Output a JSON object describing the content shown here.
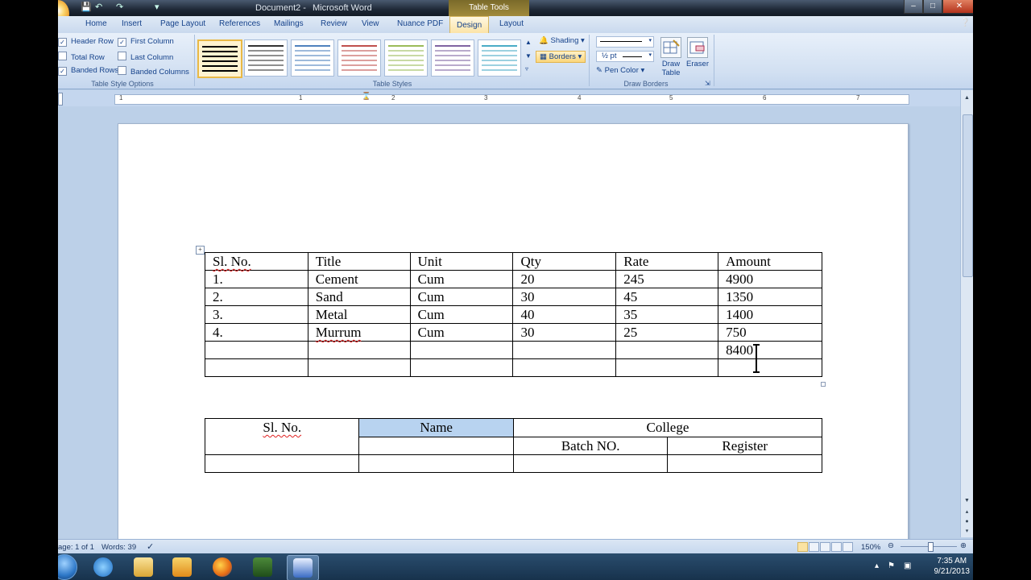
{
  "window": {
    "doc_title": "Document2 -",
    "app_name": "Microsoft Word",
    "contextual_group": "Table Tools",
    "controls": [
      "–",
      "□",
      "✕"
    ]
  },
  "ribbon": {
    "tabs": [
      "Home",
      "Insert",
      "Page Layout",
      "References",
      "Mailings",
      "Review",
      "View",
      "Nuance PDF",
      "Design",
      "Layout"
    ],
    "active_tab": "Design",
    "table_style_options": {
      "label": "Table Style Options",
      "items": [
        {
          "label": "Header Row",
          "checked": true
        },
        {
          "label": "Total Row",
          "checked": false
        },
        {
          "label": "Banded Rows",
          "checked": true
        },
        {
          "label": "First Column",
          "checked": true
        },
        {
          "label": "Last Column",
          "checked": false
        },
        {
          "label": "Banded Columns",
          "checked": false
        }
      ]
    },
    "table_styles": {
      "label": "Table Styles",
      "swatch_colors": [
        "#000000",
        "#333333",
        "#4f81bd",
        "#c0504d",
        "#9bbb59",
        "#8064a2",
        "#4bacc6"
      ]
    },
    "shading_label": "Shading",
    "borders_label": "Borders",
    "draw_borders": {
      "label": "Draw Borders",
      "pen_weight": "½ pt",
      "pen_color": "Pen Color",
      "draw_table": "Draw Table",
      "eraser": "Eraser"
    }
  },
  "ruler": {
    "numbers": [
      "1",
      "1",
      "2",
      "3",
      "4",
      "5",
      "6",
      "7"
    ]
  },
  "document": {
    "table1": {
      "headers": [
        "Sl. No.",
        "Title",
        "Unit",
        "Qty",
        "Rate",
        "Amount"
      ],
      "rows": [
        [
          "1.",
          "Cement",
          "Cum",
          "20",
          "245",
          "4900"
        ],
        [
          "2.",
          "Sand",
          "Cum",
          "30",
          "45",
          "1350"
        ],
        [
          "3.",
          "Metal",
          "Cum",
          "40",
          "35",
          "1400"
        ],
        [
          "4.",
          "Murrum",
          "Cum",
          "30",
          "25",
          "750"
        ],
        [
          "",
          "",
          "",
          "",
          "",
          "8400"
        ],
        [
          "",
          "",
          "",
          "",
          "",
          ""
        ]
      ]
    },
    "table2": {
      "sl_no": "Sl. No.",
      "name": "Name",
      "college": "College",
      "batch_no": "Batch NO.",
      "register": "Register"
    }
  },
  "status_bar": {
    "page": "age: 1 of 1",
    "words": "Words: 39",
    "zoom": "150%"
  },
  "taskbar": {
    "time": "7:35 AM",
    "date": "9/21/2013"
  }
}
